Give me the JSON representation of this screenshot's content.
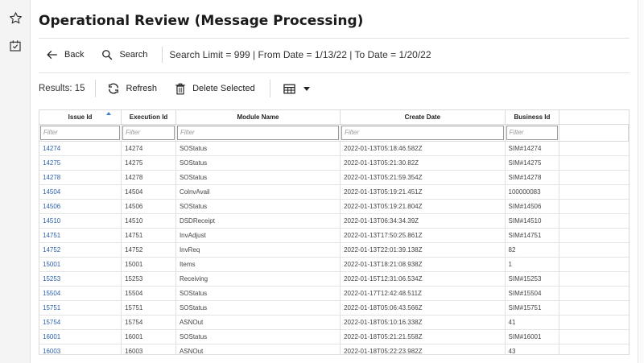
{
  "rail": {
    "favorite_icon": "star-icon",
    "tasks_icon": "checklist-icon"
  },
  "page": {
    "title": "Operational Review (Message Processing)"
  },
  "toolbar": {
    "back_label": "Back",
    "search_label": "Search",
    "criteria": "Search Limit = 999 | From Date = 1/13/22 | To Date = 1/20/22"
  },
  "actions": {
    "results": "Results: 15",
    "refresh_label": "Refresh",
    "delete_label": "Delete Selected",
    "view_icon": "table-view-icon"
  },
  "table": {
    "headers": [
      "Issue Id",
      "Execution Id",
      "Module Name",
      "Create Date",
      "Business Id"
    ],
    "filter_placeholder": "Filter",
    "rows": [
      [
        "14274",
        "14274",
        "SOStatus",
        "2022-01-13T05:18:46.582Z",
        "SIM#14274"
      ],
      [
        "14275",
        "14275",
        "SOStatus",
        "2022-01-13T05:21:30.82Z",
        "SIM#14275"
      ],
      [
        "14278",
        "14278",
        "SOStatus",
        "2022-01-13T05:21:59.354Z",
        "SIM#14278"
      ],
      [
        "14504",
        "14504",
        "ColnvAvail",
        "2022-01-13T05:19:21.451Z",
        "100000083"
      ],
      [
        "14506",
        "14506",
        "SOStatus",
        "2022-01-13T05:19:21.804Z",
        "SIM#14506"
      ],
      [
        "14510",
        "14510",
        "DSDReceipt",
        "2022-01-13T06:34:34.39Z",
        "SIM#14510"
      ],
      [
        "14751",
        "14751",
        "InvAdjust",
        "2022-01-13T17:50:25.861Z",
        "SIM#14751"
      ],
      [
        "14752",
        "14752",
        "InvReq",
        "2022-01-13T22:01:39.138Z",
        "82"
      ],
      [
        "15001",
        "15001",
        "Items",
        "2022-01-13T18:21:08.938Z",
        "1"
      ],
      [
        "15253",
        "15253",
        "Receiving",
        "2022-01-15T12:31:06.534Z",
        "SIM#15253"
      ],
      [
        "15504",
        "15504",
        "SOStatus",
        "2022-01-17T12:42:48.511Z",
        "SIM#15504"
      ],
      [
        "15751",
        "15751",
        "SOStatus",
        "2022-01-18T05:06:43.566Z",
        "SIM#15751"
      ],
      [
        "15754",
        "15754",
        "ASNOut",
        "2022-01-18T05:10:16.338Z",
        "41"
      ],
      [
        "16001",
        "16001",
        "SOStatus",
        "2022-01-18T05:21:21.558Z",
        "SIM#16001"
      ],
      [
        "16003",
        "16003",
        "ASNOut",
        "2022-01-18T05:22:23.982Z",
        "43"
      ]
    ]
  }
}
